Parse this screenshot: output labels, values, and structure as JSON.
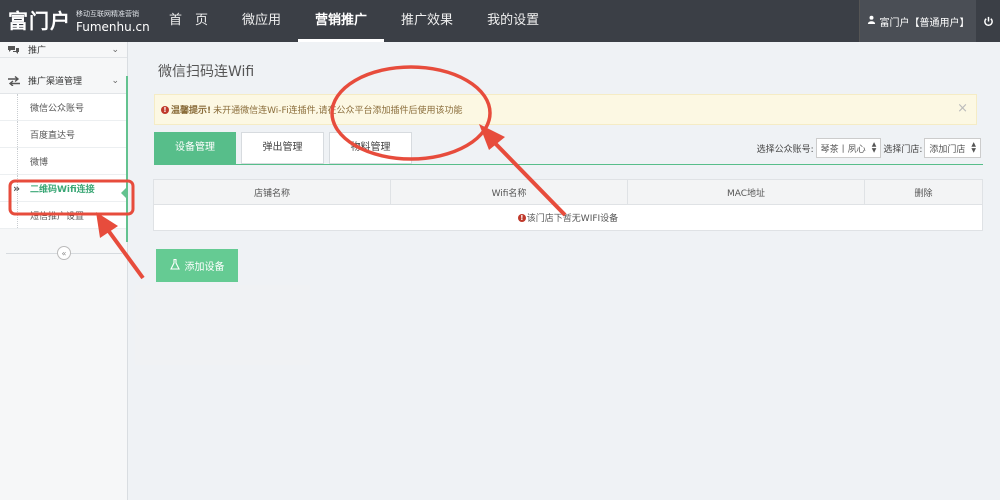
{
  "brand": {
    "name": "富门户",
    "tagline": "移动互联网精准营销",
    "domain": "Fumenhu.cn"
  },
  "nav": {
    "items": [
      {
        "label": "首　页"
      },
      {
        "label": "微应用"
      },
      {
        "label": "营销推广",
        "active": true
      },
      {
        "label": "推广效果"
      },
      {
        "label": "我的设置"
      }
    ]
  },
  "user": {
    "label": "富门户【普通用户】",
    "icon": "user-icon",
    "logout_icon": "power-icon"
  },
  "sidebar": {
    "top_group": {
      "label": "推广"
    },
    "group": {
      "label": "推广渠道管理"
    },
    "items": [
      {
        "label": "微信公众账号"
      },
      {
        "label": "百度直达号"
      },
      {
        "label": "微博"
      },
      {
        "label": "二维码Wifi连接",
        "active": true
      },
      {
        "label": "短信推广设置"
      }
    ],
    "collapse_icon": "double-chevron-left-icon"
  },
  "main": {
    "title": "微信扫码连Wifi",
    "notice": {
      "strong": "温馨提示!",
      "text": "未开通微信连Wi-Fi连插件,请在公众平台添加插件后使用该功能",
      "close": "×"
    },
    "tabs": [
      {
        "label": "设备管理",
        "active": true
      },
      {
        "label": "弹出管理"
      },
      {
        "label": "物料管理"
      }
    ],
    "filters": {
      "account_label": "选择公众账号:",
      "account_value": "琴茶丨夙心",
      "store_label": "选择门店:",
      "store_value": "添加门店"
    },
    "table": {
      "columns": [
        "店铺名称",
        "Wifi名称",
        "MAC地址",
        "删除"
      ],
      "empty_text": "该门店下暂无WIFI设备"
    },
    "add_button": "添加设备"
  },
  "colors": {
    "topbar": "#3b3f46",
    "accent": "#57be8a",
    "annotation": "#e74c3c"
  }
}
